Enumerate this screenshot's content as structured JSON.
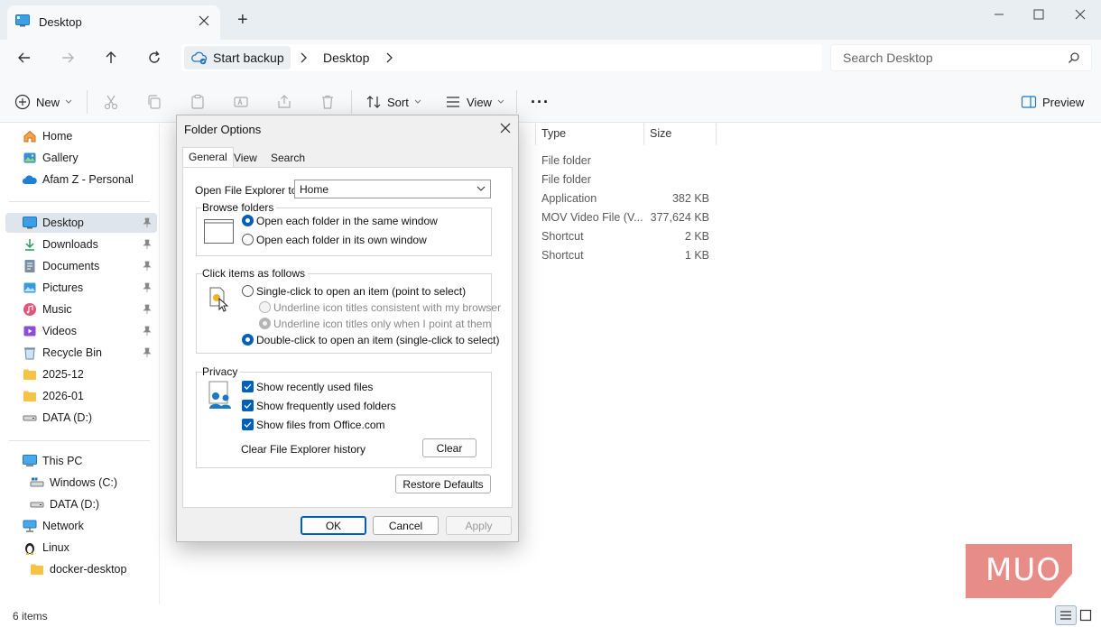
{
  "window": {
    "tab_title": "Desktop",
    "new_tab_glyph": "+"
  },
  "navbar": {
    "breadcrumb": [
      "Start backup",
      "Desktop"
    ],
    "search_placeholder": "Search Desktop"
  },
  "commandbar": {
    "new_label": "New",
    "sort_label": "Sort",
    "view_label": "View",
    "more_glyph": "···",
    "preview_label": "Preview"
  },
  "sidebar": {
    "pinned": [
      {
        "label": "Home",
        "icon": "home-icon"
      },
      {
        "label": "Gallery",
        "icon": "gallery-icon"
      },
      {
        "label": "Afam Z - Personal",
        "icon": "onedrive-cloud-icon"
      }
    ],
    "quick_access": [
      {
        "label": "Desktop",
        "icon": "desktop-icon",
        "pinned": true,
        "selected": true
      },
      {
        "label": "Downloads",
        "icon": "downloads-icon",
        "pinned": true
      },
      {
        "label": "Documents",
        "icon": "documents-icon",
        "pinned": true
      },
      {
        "label": "Pictures",
        "icon": "pictures-icon",
        "pinned": true
      },
      {
        "label": "Music",
        "icon": "music-icon",
        "pinned": true
      },
      {
        "label": "Videos",
        "icon": "videos-icon",
        "pinned": true
      },
      {
        "label": "Recycle Bin",
        "icon": "recycle-bin-icon",
        "pinned": true
      },
      {
        "label": "2025-12",
        "icon": "folder-icon"
      },
      {
        "label": "2026-01",
        "icon": "folder-icon"
      },
      {
        "label": "DATA (D:)",
        "icon": "drive-icon"
      }
    ],
    "devices": [
      {
        "label": "This PC",
        "icon": "pc-icon"
      },
      {
        "label": "Windows (C:)",
        "icon": "windows-drive-icon",
        "sub": true
      },
      {
        "label": "DATA (D:)",
        "icon": "drive-icon",
        "sub": true
      },
      {
        "label": "Network",
        "icon": "network-icon"
      },
      {
        "label": "Linux",
        "icon": "linux-icon"
      },
      {
        "label": "docker-desktop",
        "icon": "folder-icon",
        "sub": true
      }
    ]
  },
  "filelist": {
    "columns": [
      "Type",
      "Size"
    ],
    "rows": [
      {
        "type": "File folder",
        "size": ""
      },
      {
        "type": "File folder",
        "size": ""
      },
      {
        "type": "Application",
        "size": "382 KB"
      },
      {
        "type": "MOV Video File (V...",
        "size": "377,624 KB"
      },
      {
        "type": "Shortcut",
        "size": "2 KB"
      },
      {
        "type": "Shortcut",
        "size": "1 KB"
      }
    ]
  },
  "status": {
    "item_count": "6 items"
  },
  "dialog": {
    "title": "Folder Options",
    "tabs": [
      "General",
      "View",
      "Search"
    ],
    "open_explorer_label": "Open File Explorer to:",
    "open_explorer_value": "Home",
    "browse_group": "Browse folders",
    "browse_same": "Open each folder in the same window",
    "browse_own": "Open each folder in its own window",
    "click_group": "Click items as follows",
    "single_click": "Single-click to open an item (point to select)",
    "underline_browser": "Underline icon titles consistent with my browser",
    "underline_point": "Underline icon titles only when I point at them",
    "double_click": "Double-click to open an item (single-click to select)",
    "privacy_group": "Privacy",
    "recent_files": "Show recently used files",
    "frequent_folders": "Show frequently used folders",
    "office_files": "Show files from Office.com",
    "clear_history_label": "Clear File Explorer history",
    "clear_button": "Clear",
    "restore_button": "Restore Defaults",
    "ok_button": "OK",
    "cancel_button": "Cancel",
    "apply_button": "Apply"
  },
  "watermark": {
    "text": "MUO"
  },
  "colors": {
    "accent": "#005fb8",
    "titlebar": "#e9eef3",
    "selected_nav": "#dfe5ec"
  }
}
